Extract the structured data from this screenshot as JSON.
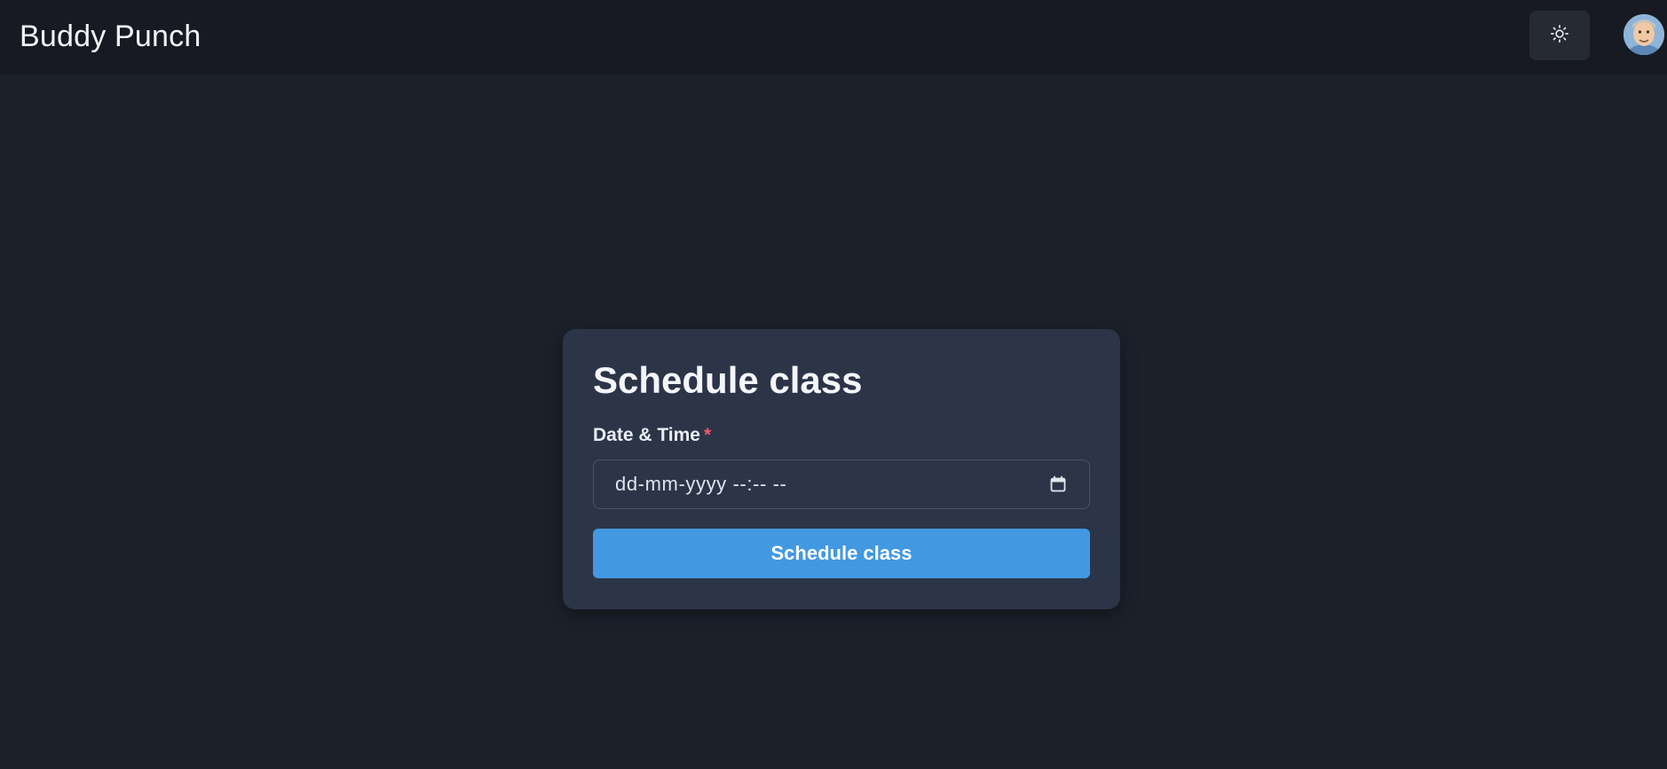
{
  "header": {
    "brand": "Buddy Punch",
    "theme_toggle_icon": "sun-icon",
    "avatar_icon": "user-avatar"
  },
  "form": {
    "title": "Schedule class",
    "datetime_label": "Date & Time",
    "required_mark": "*",
    "datetime_placeholder": "dd-mm-yyyy --:-- --",
    "calendar_icon": "calendar-icon",
    "submit_label": "Schedule class"
  },
  "colors": {
    "background": "#1b202b",
    "topbar": "#171a22",
    "card": "#2c3547",
    "accent": "#4299e1",
    "required": "#ef5a67"
  }
}
